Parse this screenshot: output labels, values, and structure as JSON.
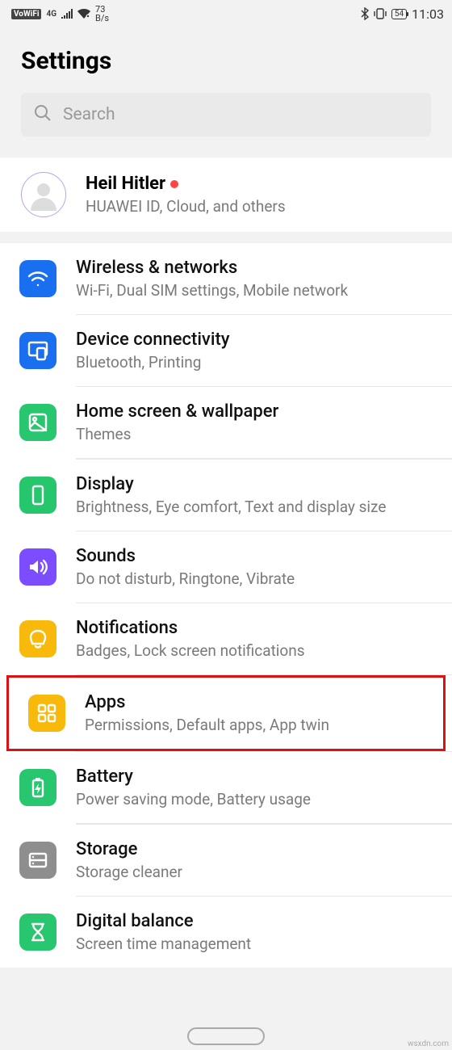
{
  "status": {
    "vowifi": "VoWiFi",
    "net_gen": "4G",
    "speed_top": "73",
    "speed_bot": "B/s",
    "battery": "54",
    "time": "11:03"
  },
  "page_title": "Settings",
  "search": {
    "placeholder": "Search"
  },
  "account": {
    "name": "Heil Hitler",
    "sub": "HUAWEI ID, Cloud, and others"
  },
  "items": [
    {
      "title": "Wireless & networks",
      "sub": "Wi-Fi, Dual SIM settings, Mobile network",
      "icon": "wifi",
      "bg": "bg-blue"
    },
    {
      "title": "Device connectivity",
      "sub": "Bluetooth, Printing",
      "icon": "device",
      "bg": "bg-blue2"
    },
    {
      "title": "Home screen & wallpaper",
      "sub": "Themes",
      "icon": "picture",
      "bg": "bg-green"
    },
    {
      "title": "Display",
      "sub": "Brightness, Eye comfort, Text and display size",
      "icon": "display",
      "bg": "bg-green2"
    },
    {
      "title": "Sounds",
      "sub": "Do not disturb, Ringtone, Vibrate",
      "icon": "sound",
      "bg": "bg-purple"
    },
    {
      "title": "Notifications",
      "sub": "Badges, Lock screen notifications",
      "icon": "bell",
      "bg": "bg-yellow"
    },
    {
      "title": "Apps",
      "sub": "Permissions, Default apps, App twin",
      "icon": "apps",
      "bg": "bg-yellow2",
      "highlight": true
    },
    {
      "title": "Battery",
      "sub": "Power saving mode, Battery usage",
      "icon": "battery",
      "bg": "bg-green3"
    },
    {
      "title": "Storage",
      "sub": "Storage cleaner",
      "icon": "storage",
      "bg": "bg-gray"
    },
    {
      "title": "Digital balance",
      "sub": "Screen time management",
      "icon": "hourglass",
      "bg": "bg-green4"
    }
  ],
  "watermark": "wsxdn.com"
}
